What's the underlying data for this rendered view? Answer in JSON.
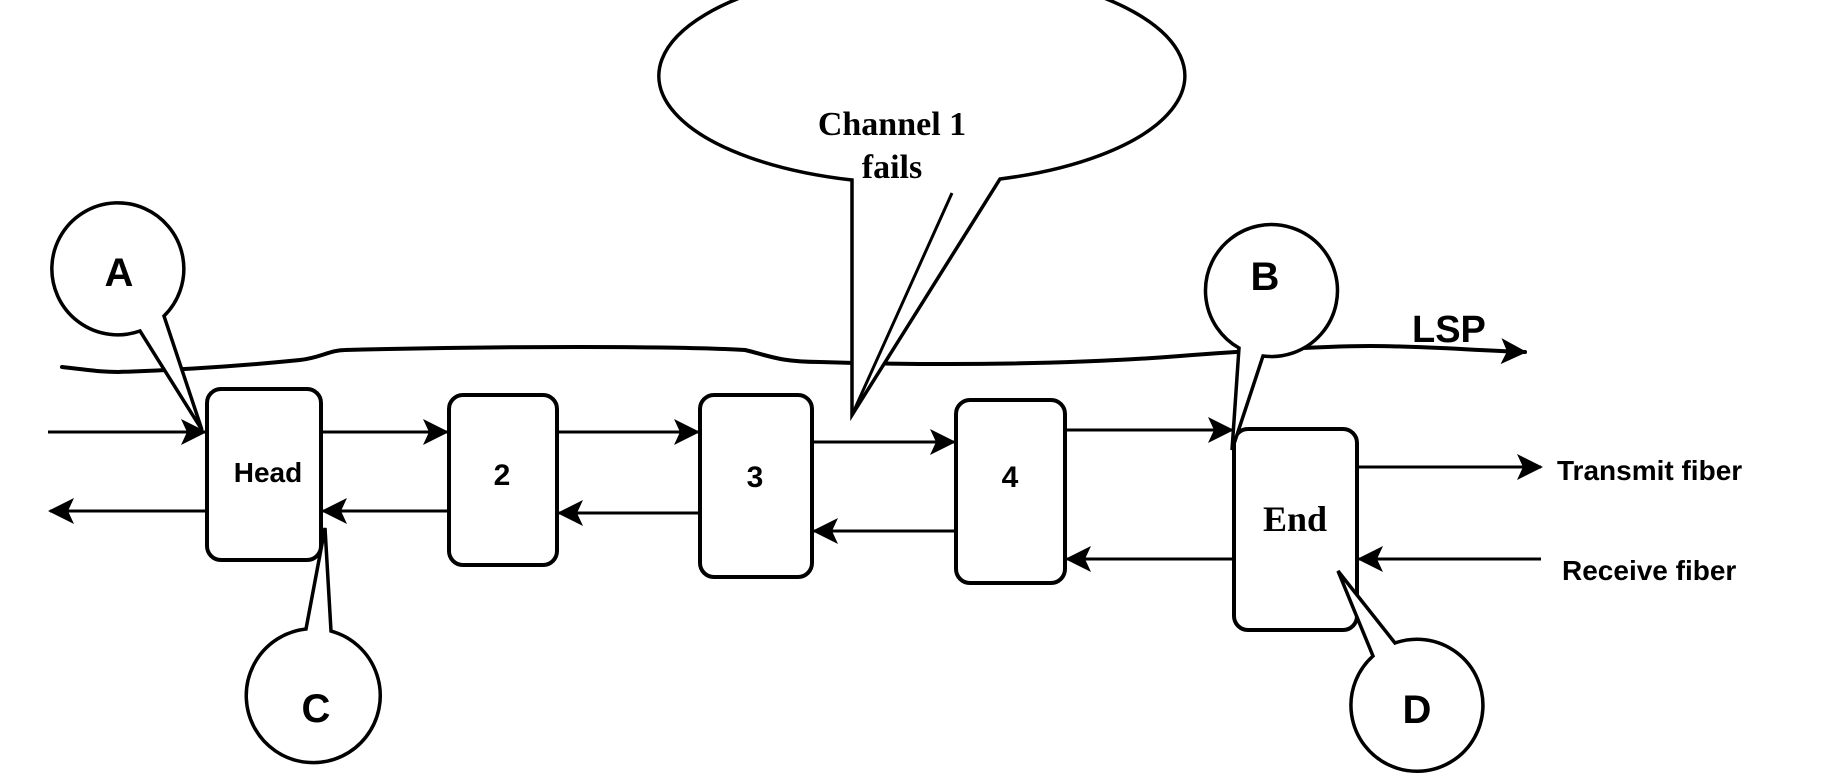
{
  "diagram": {
    "callout_main": {
      "line1": "Channel 1",
      "line2": "fails"
    },
    "markers": [
      {
        "id": "A",
        "label": "A"
      },
      {
        "id": "B",
        "label": "B"
      },
      {
        "id": "C",
        "label": "C"
      },
      {
        "id": "D",
        "label": "D"
      }
    ],
    "nodes": [
      {
        "id": "head",
        "label": "Head"
      },
      {
        "id": "n2",
        "label": "2"
      },
      {
        "id": "n3",
        "label": "3"
      },
      {
        "id": "n4",
        "label": "4"
      },
      {
        "id": "end",
        "label": "End"
      }
    ],
    "lsp_label": "LSP",
    "transmit_label": "Transmit fiber",
    "receive_label": "Receive fiber",
    "colors": {
      "stroke": "#000000",
      "background": "#ffffff"
    }
  }
}
